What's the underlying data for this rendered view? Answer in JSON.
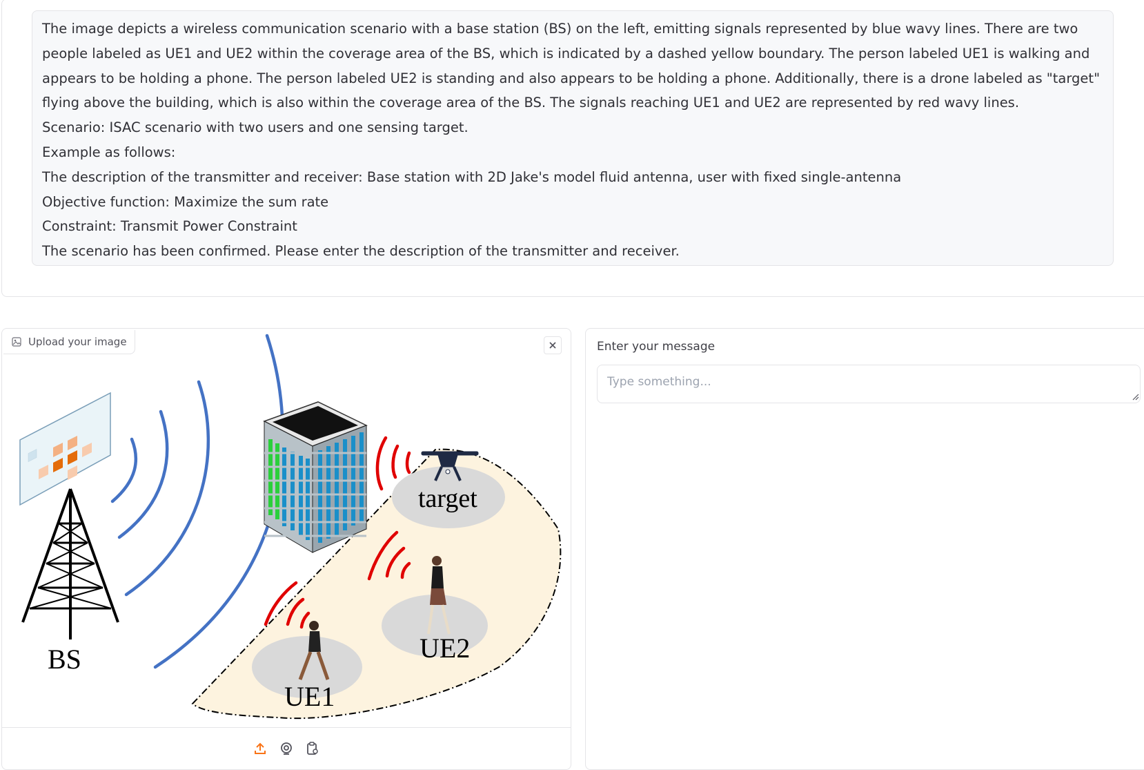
{
  "chat": {
    "message_lines": [
      "The image depicts a wireless communication scenario with a base station (BS) on the left, emitting signals represented by blue wavy lines. There are two people labeled as UE1 and UE2 within the coverage area of the BS, which is indicated by a dashed yellow boundary. The person labeled UE1 is walking and appears to be holding a phone. The person labeled UE2 is standing and also appears to be holding a phone. Additionally, there is a drone labeled as \"target\" flying above the building, which is also within the coverage area of the BS. The signals reaching UE1 and UE2 are represented by red wavy lines.",
      "Scenario: ISAC scenario with two users and one sensing target.",
      "Example as follows:",
      "The description of the transmitter and receiver: Base station with 2D Jake's model fluid antenna, user with fixed single-antenna",
      "Objective function: Maximize the sum rate",
      "Constraint: Transmit Power Constraint",
      "The scenario has been confirmed. Please enter the description of the transmitter and receiver."
    ]
  },
  "image_upload": {
    "label": "Upload your image",
    "icon": "image-icon",
    "clear_icon": "close-icon",
    "diagram": {
      "bs_label": "BS",
      "ue1_label": "UE1",
      "ue2_label": "UE2",
      "target_label": "target"
    },
    "footer_icons": [
      "upload-icon",
      "webcam-icon",
      "clipboard-icon"
    ]
  },
  "message": {
    "label": "Enter your message",
    "placeholder": "Type something...",
    "value": ""
  },
  "colors": {
    "accent": "#f97316",
    "border": "#e4e4e7",
    "message_bg": "#f7f8fa",
    "blue_wave": "#4472c4",
    "red_wave": "#e00000",
    "coverage_fill": "#fdf3df"
  }
}
